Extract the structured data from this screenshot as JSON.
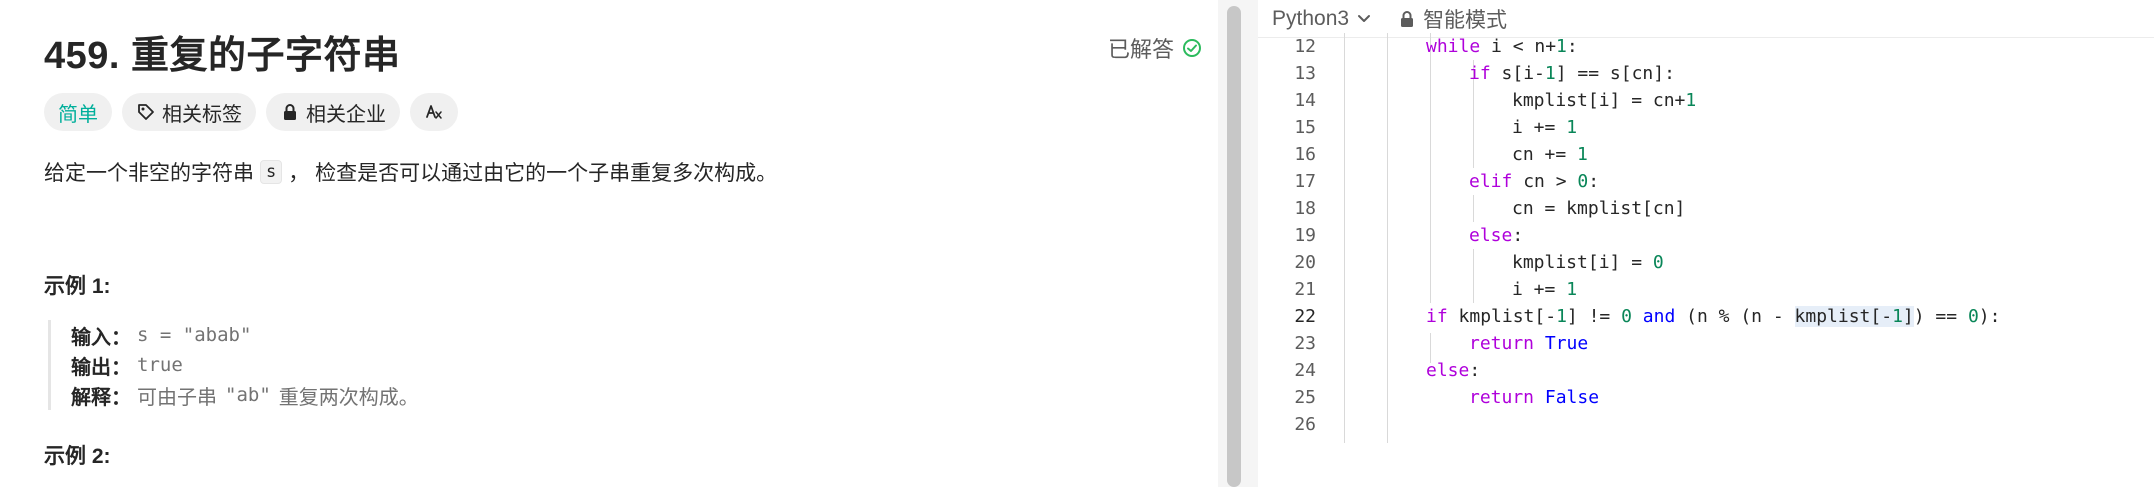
{
  "problem": {
    "title": "459. 重复的子字符串",
    "solved_label": "已解答",
    "tags": [
      {
        "label": "简单"
      },
      {
        "label": "相关标签"
      },
      {
        "label": "相关企业"
      }
    ],
    "desc_before": "给定一个非空的字符串",
    "desc_code": "s",
    "desc_after": "， 检查是否可以通过由它的一个子串重复多次构成。",
    "example1_title": "示例 1:",
    "example1": {
      "input_label": "输入：",
      "input_value": "s = \"abab\"",
      "output_label": "输出：",
      "output_value": "true",
      "explain_label": "解释：",
      "explain_before": "可由子串",
      "explain_code": "\"ab\"",
      "explain_after": "重复两次构成。"
    },
    "example2_title": "示例 2:"
  },
  "editor": {
    "language": "Python3",
    "mode": "智能模式",
    "lines": [
      {
        "no": "12",
        "code": "while i < n+1:"
      },
      {
        "no": "13",
        "code": "if s[i-1] == s[cn]:"
      },
      {
        "no": "14",
        "code": "kmplist[i] = cn+1"
      },
      {
        "no": "15",
        "code": "i += 1"
      },
      {
        "no": "16",
        "code": "cn += 1"
      },
      {
        "no": "17",
        "code": "elif cn > 0:"
      },
      {
        "no": "18",
        "code": "cn = kmplist[cn]"
      },
      {
        "no": "19",
        "code": "else:"
      },
      {
        "no": "20",
        "code": "kmplist[i] = 0"
      },
      {
        "no": "21",
        "code": "i += 1"
      },
      {
        "no": "22",
        "code": "if kmplist[-1] != 0 and (n % (n - kmplist[-1]) == 0):"
      },
      {
        "no": "23",
        "code": "return True"
      },
      {
        "no": "24",
        "code": "else:"
      },
      {
        "no": "25",
        "code": "return False"
      },
      {
        "no": "26",
        "code": ""
      }
    ]
  },
  "colors": {
    "easy": "#00af9b",
    "keyword": "#af00db",
    "builtin": "#0000ff",
    "number": "#098658",
    "solved_check": "#2cbb5d"
  }
}
